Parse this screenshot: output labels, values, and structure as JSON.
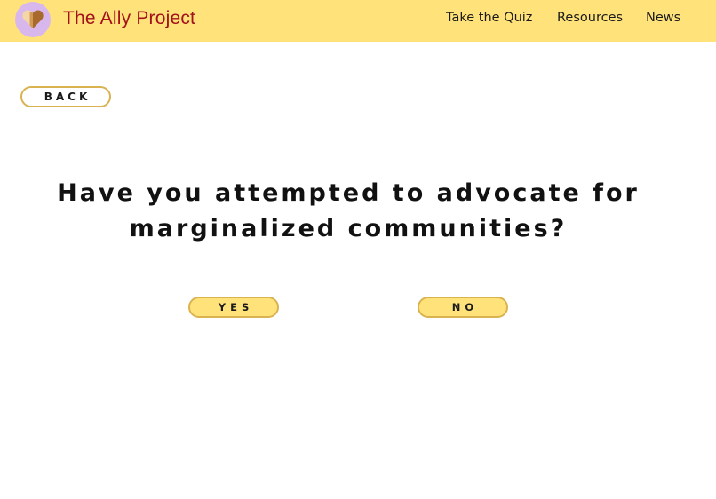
{
  "header": {
    "brand": "The Ally Project",
    "logo_icon": "heart-icon",
    "nav": {
      "quiz": "Take the Quiz",
      "resources": "Resources",
      "news": "News"
    }
  },
  "back_label": "BACK",
  "question": "Have you attempted to advocate for marginalized communities?",
  "answers": {
    "yes": "YES",
    "no": "NO"
  },
  "colors": {
    "header_bg": "#ffe37a",
    "brand_text": "#a3111b",
    "logo_circle": "#d8b8ec",
    "button_border": "#d9b350",
    "answer_bg": "#ffe37a"
  }
}
